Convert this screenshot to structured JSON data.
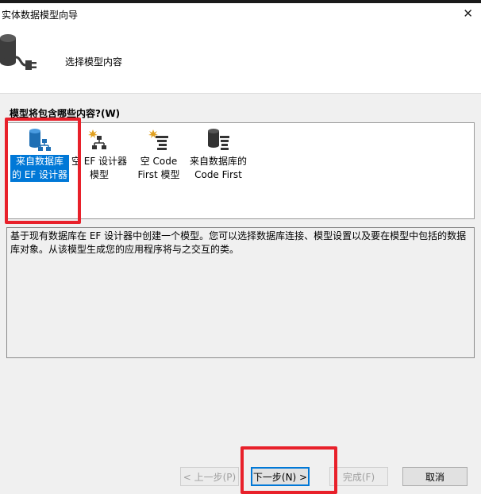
{
  "window": {
    "title": "实体数据模型向导"
  },
  "header": {
    "heading": "选择模型内容"
  },
  "content": {
    "prompt": "模型将包含哪些内容?(W)",
    "items": [
      {
        "line1": "来自数据库",
        "line2": "的 EF 设计器",
        "selected": true,
        "icon": "database-designer-icon"
      },
      {
        "line1": "空 EF 设计器",
        "line2": "模型",
        "selected": false,
        "icon": "empty-designer-icon"
      },
      {
        "line1": "空 Code",
        "line2": "First 模型",
        "selected": false,
        "icon": "empty-code-first-icon"
      },
      {
        "line1": "来自数据库的",
        "line2": "Code First",
        "selected": false,
        "icon": "database-code-first-icon"
      }
    ],
    "description": "基于现有数据库在 EF 设计器中创建一个模型。您可以选择数据库连接、模型设置以及要在模型中包括的数据库对象。从该模型生成您的应用程序将与之交互的类。"
  },
  "footer": {
    "prev_label": "< 上一步(P)",
    "next_label": "下一步(N) >",
    "finish_label": "完成(F)",
    "cancel_label": "取消"
  },
  "colors": {
    "selection": "#0078d7",
    "highlight": "#e8202a"
  }
}
